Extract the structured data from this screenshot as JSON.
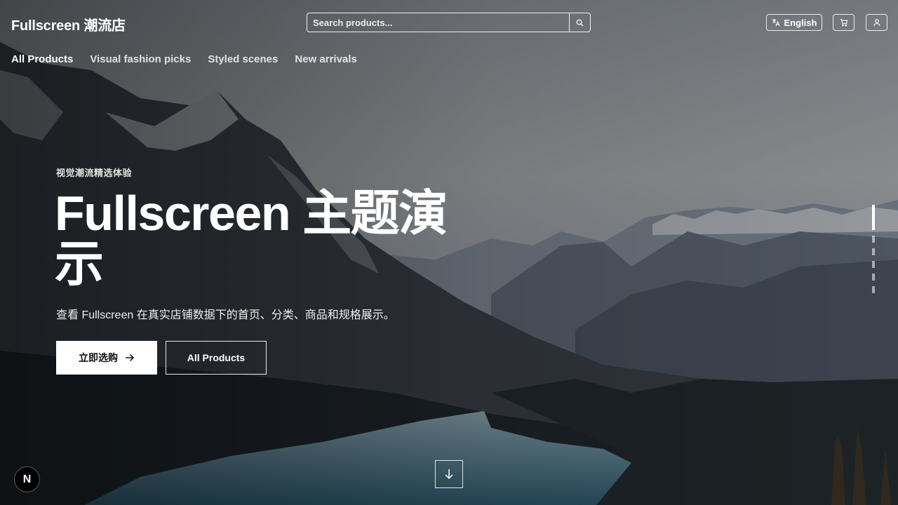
{
  "header": {
    "logo": "Fullscreen 潮流店",
    "search_placeholder": "Search products...",
    "language": "English"
  },
  "nav": [
    {
      "label": "All Products",
      "active": true
    },
    {
      "label": "Visual fashion picks"
    },
    {
      "label": "Styled scenes"
    },
    {
      "label": "New arrivals"
    }
  ],
  "hero": {
    "eyebrow": "视觉潮流精选体验",
    "title": "Fullscreen 主题演示",
    "subtitle": "查看 Fullscreen 在真实店铺数据下的首页、分类、商品和规格展示。",
    "primary_cta": "立即选购",
    "secondary_cta": "All Products",
    "slide_count": 6,
    "active_slide": 1
  },
  "dev_badge": "N",
  "icons": [
    "search-icon",
    "translate-icon",
    "cart-icon",
    "user-icon",
    "arrow-right-icon",
    "arrow-down-icon"
  ]
}
